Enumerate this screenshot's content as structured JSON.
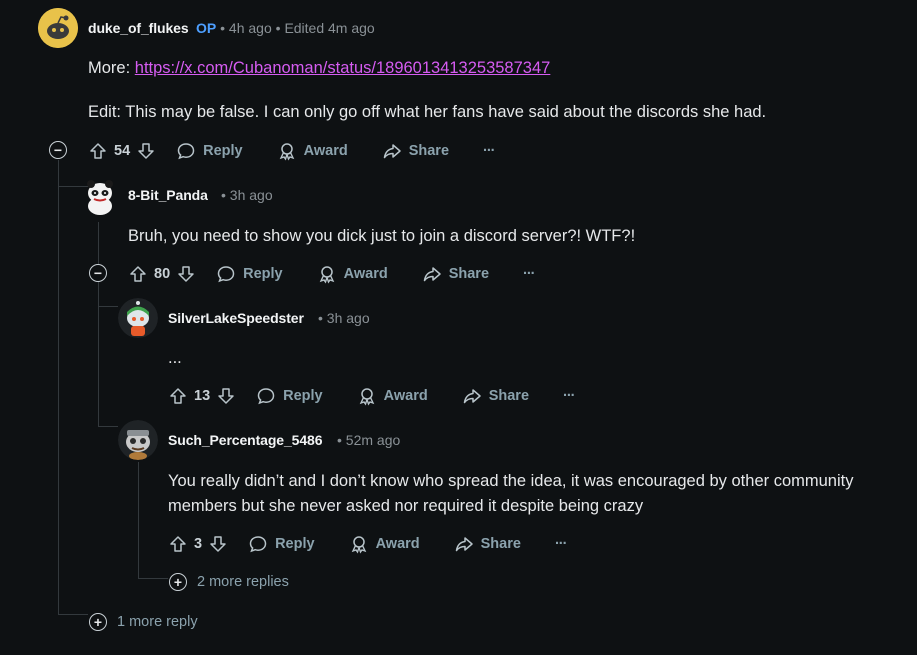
{
  "comments": [
    {
      "username": "duke_of_flukes",
      "op_badge": "OP",
      "time": "4h ago",
      "edited": "Edited 4m ago",
      "text_prefix": "More: ",
      "link": "https://x.com/Cubanoman/status/1896013413253587347",
      "text": "Edit: This may be false. I can only go off what her fans have said about the discords she had.",
      "votes": "54"
    },
    {
      "username": "8-Bit_Panda",
      "time": "3h ago",
      "text": "Bruh, you need to show you dick just to join a discord server?! WTF?!",
      "votes": "80"
    },
    {
      "username": "SilverLakeSpeedster",
      "time": "3h ago",
      "text": "...",
      "votes": "13"
    },
    {
      "username": "Such_Percentage_5486",
      "time": "52m ago",
      "text": "You really didn’t and I don’t know who spread the idea, it was encouraged by other community members but she never asked nor required it despite being crazy",
      "votes": "3"
    }
  ],
  "labels": {
    "reply": "Reply",
    "award": "Award",
    "share": "Share",
    "overflow": "···",
    "separator": "•"
  },
  "more_replies": {
    "nested": "2 more replies",
    "top": "1 more reply"
  },
  "colors": {
    "background": "#0e1113",
    "link": "#d65cf2",
    "op": "#4d9fff",
    "muted": "#8ba2ad"
  }
}
